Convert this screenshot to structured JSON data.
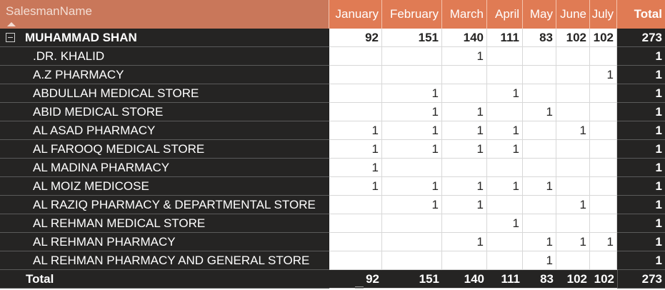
{
  "header": {
    "row_label": "SalesmanName",
    "months": [
      "January",
      "February",
      "March",
      "April",
      "May",
      "June",
      "July"
    ],
    "total_label": "Total"
  },
  "group": {
    "name": "MUHAMMAD SHAN",
    "values": [
      "92",
      "151",
      "140",
      "111",
      "83",
      "102",
      "102"
    ],
    "total": "273"
  },
  "rows": [
    {
      "name": ".DR. KHALID",
      "values": [
        "",
        "",
        "1",
        "",
        "",
        "",
        ""
      ],
      "total": "1"
    },
    {
      "name": "A.Z PHARMACY",
      "values": [
        "",
        "",
        "",
        "",
        "",
        "",
        "1"
      ],
      "total": "1"
    },
    {
      "name": "ABDULLAH MEDICAL STORE",
      "values": [
        "",
        "1",
        "",
        "1",
        "",
        "",
        ""
      ],
      "total": "1"
    },
    {
      "name": "ABID MEDICAL STORE",
      "values": [
        "",
        "1",
        "1",
        "",
        "1",
        "",
        ""
      ],
      "total": "1"
    },
    {
      "name": "AL ASAD PHARMACY",
      "values": [
        "1",
        "1",
        "1",
        "1",
        "",
        "1",
        ""
      ],
      "total": "1"
    },
    {
      "name": "AL FAROOQ MEDICAL STORE",
      "values": [
        "1",
        "1",
        "1",
        "1",
        "",
        "",
        ""
      ],
      "total": "1"
    },
    {
      "name": "AL MADINA PHARMACY",
      "values": [
        "1",
        "",
        "",
        "",
        "",
        "",
        ""
      ],
      "total": "1"
    },
    {
      "name": "AL MOIZ MEDICOSE",
      "values": [
        "1",
        "1",
        "1",
        "1",
        "1",
        "",
        ""
      ],
      "total": "1"
    },
    {
      "name": "AL RAZIQ PHARMACY & DEPARTMENTAL STORE",
      "values": [
        "",
        "1",
        "1",
        "",
        "",
        "1",
        ""
      ],
      "total": "1"
    },
    {
      "name": "AL REHMAN MEDICAL STORE",
      "values": [
        "",
        "",
        "",
        "1",
        "",
        "",
        ""
      ],
      "total": "1"
    },
    {
      "name": "AL REHMAN PHARMACY",
      "values": [
        "",
        "",
        "1",
        "",
        "1",
        "1",
        "1"
      ],
      "total": "1"
    },
    {
      "name": "AL REHMAN PHARMACY AND GENERAL STORE",
      "values": [
        "",
        "",
        "",
        "",
        "1",
        "",
        ""
      ],
      "total": "1"
    }
  ],
  "grand_total": {
    "label": "Total",
    "values": [
      "92",
      "151",
      "140",
      "111",
      "83",
      "102",
      "102"
    ],
    "total": "273"
  },
  "colors": {
    "header_bg": "#e07b54",
    "header_name_bg": "#c9775a",
    "dark_bg": "#252423"
  }
}
